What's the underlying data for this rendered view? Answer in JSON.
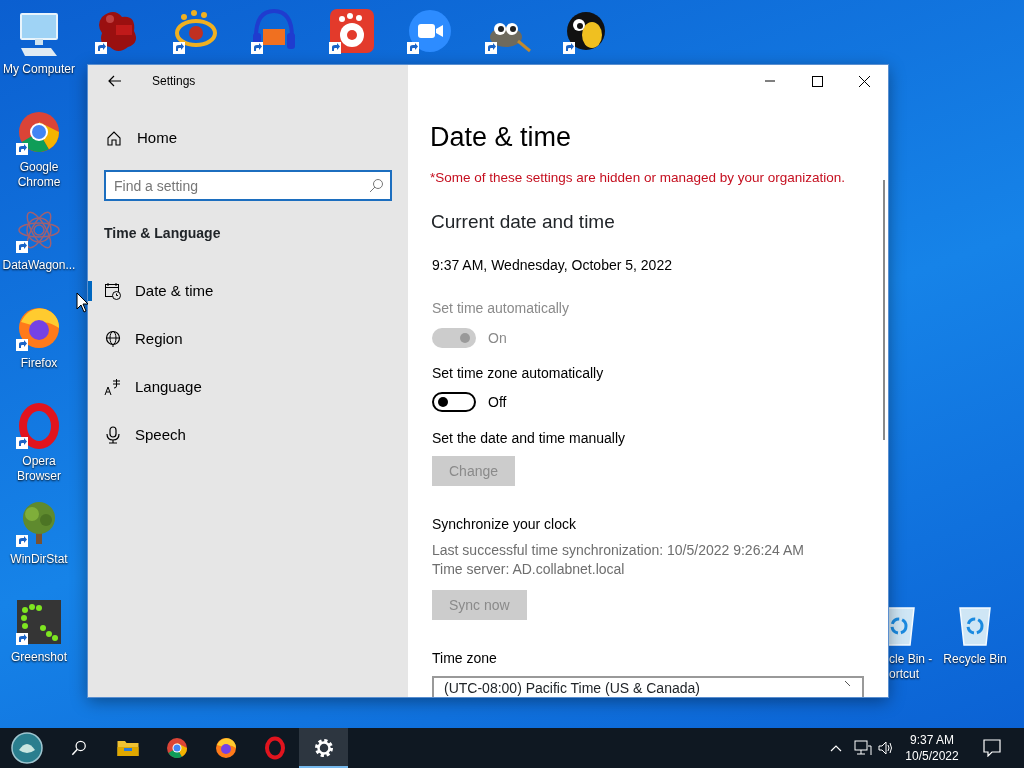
{
  "desktop": {
    "column": [
      {
        "label": "My Computer",
        "kind": "computer",
        "shortcut": false
      },
      {
        "label": "Google Chrome",
        "kind": "chrome",
        "shortcut": true
      },
      {
        "label": "DataWagon...",
        "kind": "datawagon",
        "shortcut": true
      },
      {
        "label": "Firefox",
        "kind": "firefox",
        "shortcut": true
      },
      {
        "label": "Opera Browser",
        "kind": "opera",
        "shortcut": true
      },
      {
        "label": "WinDirStat",
        "kind": "windirstat",
        "shortcut": true
      },
      {
        "label": "Greenshot",
        "kind": "greenshot",
        "shortcut": true
      }
    ],
    "top_row": [
      {
        "kind": "irfanview",
        "shortcut": true
      },
      {
        "kind": "xnview",
        "shortcut": true
      },
      {
        "kind": "audacity",
        "shortcut": true
      },
      {
        "kind": "gom",
        "shortcut": true
      },
      {
        "kind": "zoom",
        "shortcut": true
      },
      {
        "kind": "gimp",
        "shortcut": true
      },
      {
        "kind": "musicbee",
        "shortcut": true
      }
    ],
    "corner": [
      {
        "label": "cle Bin - ortcut",
        "kind": "recycle"
      },
      {
        "label": "Recycle Bin",
        "kind": "recycle"
      }
    ]
  },
  "window": {
    "title": "Settings",
    "nav": {
      "home": "Home",
      "search_placeholder": "Find a setting",
      "section": "Time & Language",
      "items": [
        {
          "label": "Date & time",
          "kind": "calendar",
          "selected": true
        },
        {
          "label": "Region",
          "kind": "globe",
          "selected": false
        },
        {
          "label": "Language",
          "kind": "language",
          "selected": false
        },
        {
          "label": "Speech",
          "kind": "mic",
          "selected": false
        }
      ]
    },
    "page": {
      "heading": "Date & time",
      "notice": "*Some of these settings are hidden or managed by your organization.",
      "section": "Current date and time",
      "current": "9:37 AM, Wednesday, October 5, 2022",
      "settings": [
        {
          "kind": "toggle",
          "label": "Set time automatically",
          "on": true,
          "disabled": true,
          "state_text": "On"
        },
        {
          "kind": "toggle",
          "label": "Set time zone automatically",
          "on": false,
          "disabled": false,
          "state_text": "Off"
        },
        {
          "kind": "button",
          "label": "Set the date and time manually",
          "button": "Change",
          "disabled": true
        },
        {
          "kind": "sync",
          "label": "Synchronize your clock",
          "lines": [
            "Last successful time synchronization: 10/5/2022 9:26:24 AM",
            "Time server: AD.collabnet.local"
          ],
          "button": "Sync now",
          "disabled": true
        },
        {
          "kind": "dropdown",
          "label": "Time zone",
          "value": "(UTC-08:00) Pacific Time (US & Canada)"
        }
      ]
    }
  },
  "taskbar": {
    "apps": [
      {
        "kind": "search",
        "active": false
      },
      {
        "kind": "explorer",
        "active": false
      },
      {
        "kind": "chrome",
        "active": false
      },
      {
        "kind": "firefox",
        "active": false
      },
      {
        "kind": "opera",
        "active": false
      },
      {
        "kind": "settings",
        "active": true
      }
    ],
    "clock": {
      "time": "9:37 AM",
      "date": "10/5/2022"
    }
  }
}
